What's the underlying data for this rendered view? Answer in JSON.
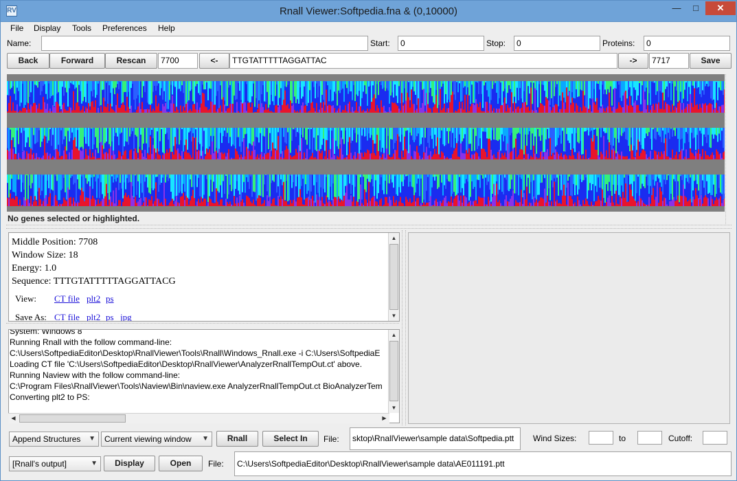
{
  "window": {
    "title": "Rnall Viewer:Softpedia.fna &  (0,10000)",
    "minimize": "—",
    "maximize": "□",
    "close": "✕",
    "icon": "RV"
  },
  "menu": [
    "File",
    "Display",
    "Tools",
    "Preferences",
    "Help"
  ],
  "search": {
    "name_label": "Name:",
    "name_value": "",
    "start_label": "Start:",
    "start_value": "0",
    "stop_label": "Stop:",
    "stop_value": "0",
    "proteins_label": "Proteins:",
    "proteins_value": "0"
  },
  "navbar": {
    "back": "Back",
    "forward": "Forward",
    "rescan": "Rescan",
    "left_pos": "7700",
    "left_arrow": "<-",
    "sequence": "TTGTATTTTTAGGATTAC",
    "right_arrow": "->",
    "right_pos": "7717",
    "save": "Save"
  },
  "heatmap": {
    "colors": [
      "#1a2cf0",
      "#2a60ff",
      "#0aa8ff",
      "#18e6ff",
      "#35f07a",
      "#8a32e8",
      "#e8142c"
    ],
    "tracks": 3
  },
  "status": "No genes selected or highlighted.",
  "info": {
    "middle": "Middle Position: 7708",
    "window_size": "Window Size: 18",
    "energy": "Energy: 1.0",
    "sequence": "Sequence: TTTGTATTTTTAGGATTACG",
    "view_label": "View:",
    "view_links": [
      "CT file",
      "plt2",
      "ps"
    ],
    "save_label": "Save As:",
    "save_links": [
      "CT file",
      "plt2",
      "ps",
      "jpg"
    ]
  },
  "log": [
    "System: Windows 8",
    "Running Rnall with the follow command-line:",
    "C:\\Users\\SoftpediaEditor\\Desktop\\RnallViewer\\Tools\\Rnall\\Windows_Rnall.exe -i C:\\Users\\SoftpediaE",
    "Loading CT  file 'C:\\Users\\SoftpediaEditor\\Desktop\\RnallViewer\\AnalyzerRnallTempOut.ct' above.",
    "Running Naview with the follow command-line:",
    "C:\\Program Files\\RnallViewer\\Tools\\Naview\\Bin\\naview.exe AnalyzerRnallTempOut.ct BioAnalyzerTem",
    "Converting plt2 to PS:"
  ],
  "bottom": {
    "append": "Append Structures",
    "window": "Current viewing window",
    "rnall": "Rnall",
    "select_in": "Select In",
    "file_label": "File:",
    "file1": "sktop\\RnallViewer\\sample data\\Softpedia.ptt",
    "wind_sizes": "Wind Sizes:",
    "to": "to",
    "cutoff": "Cutoff:",
    "output": "[Rnall's output]",
    "display": "Display",
    "open": "Open",
    "file2_label": "File:",
    "file2": "C:\\Users\\SoftpediaEditor\\Desktop\\RnallViewer\\sample data\\AE011191.ptt"
  }
}
